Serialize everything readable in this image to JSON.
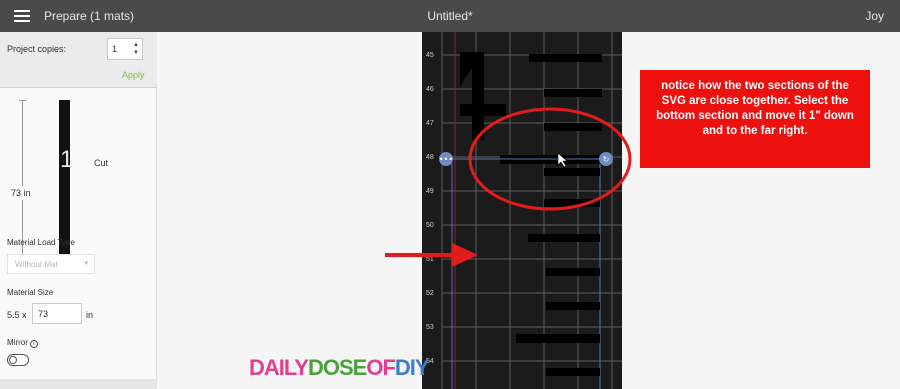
{
  "header": {
    "title": "Prepare (1 mats)",
    "document": "Untitled*",
    "user": "Joy"
  },
  "left_panel": {
    "copies_label": "Project copies:",
    "copies_value": "1",
    "apply_label": "Apply",
    "mat_length": "73 in",
    "mat_number": "1",
    "mat_mode": "Cut",
    "material_load_type_label": "Material Load Type",
    "material_load_type_value": "Without Mat",
    "material_size_label": "Material Size",
    "material_size_prefix": "5.5 x",
    "material_size_value": "73",
    "material_size_unit": "in",
    "mirror_label": "Mirror"
  },
  "mat": {
    "ruler_labels": [
      "45",
      "46",
      "47",
      "48",
      "49",
      "50",
      "51",
      "52",
      "53",
      "54"
    ]
  },
  "callout": {
    "text": "notice how the two sections of the SVG are close together. Select the bottom section and move it 1\" down and to the far right.",
    "color": "#ee0f0f"
  },
  "logo": {
    "daily": "DAILY",
    "dose": "DOSE",
    "of": "OF",
    "diy": "DIY"
  },
  "colors": {
    "topbar": "#4a4a4a",
    "apply": "#7dc242",
    "annotation_red": "#e41b1b"
  }
}
